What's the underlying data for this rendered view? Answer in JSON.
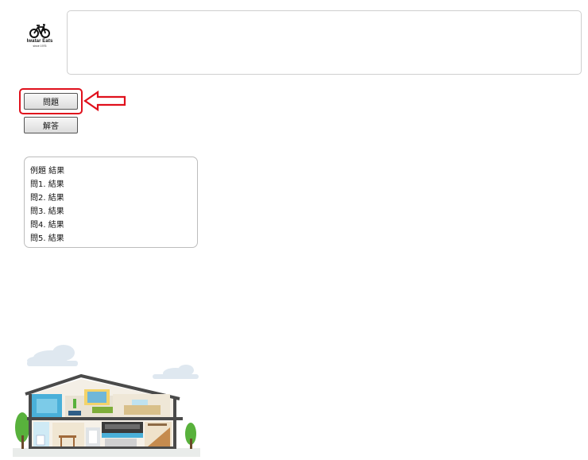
{
  "logo": {
    "brand": "Iwatar Eats",
    "since": "since 1976"
  },
  "message_box": {
    "text": ""
  },
  "buttons": {
    "mondai": "問題",
    "kaitou": "解答"
  },
  "results": [
    "例題 結果",
    "問1. 結果",
    "問2. 結果",
    "問3. 結果",
    "問4. 結果",
    "問5. 結果"
  ],
  "colors": {
    "highlight": "#e0101c"
  },
  "icons": {
    "logo": "bicycle-icon",
    "pointer": "left-arrow-icon",
    "illustration": "house-illustration"
  }
}
